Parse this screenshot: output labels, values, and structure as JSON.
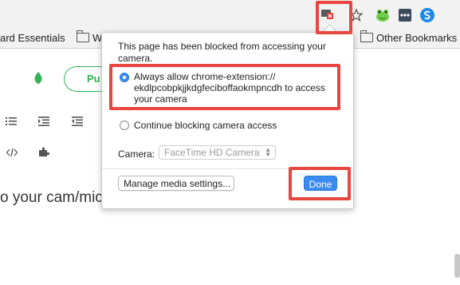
{
  "bookmarks": {
    "items": [
      {
        "label": "ard Essentials"
      },
      {
        "label": "Wa"
      },
      {
        "label": "Other Bookmarks"
      }
    ]
  },
  "toolbar": {
    "icons": [
      "camera-blocked-icon",
      "star-icon",
      "extension-frog-icon",
      "extension-dots-icon",
      "extension-s-icon"
    ]
  },
  "page": {
    "button_label": "Pu",
    "body_text": "o your cam/mic"
  },
  "popup": {
    "title": "This page has been blocked from accessing your camera.",
    "option_allow": "Always allow chrome-extension:// ekdlpcobpkjjkdgfeciboffaokmpncdh to access your camera",
    "option_block": "Continue blocking camera access",
    "camera_label": "Camera:",
    "camera_value": "FaceTime HD Camera",
    "manage_button": "Manage media settings...",
    "done_button": "Done"
  },
  "colors": {
    "highlight": "#e8463f",
    "accent": "#3a8cf0",
    "brand_green": "#2fb457"
  }
}
